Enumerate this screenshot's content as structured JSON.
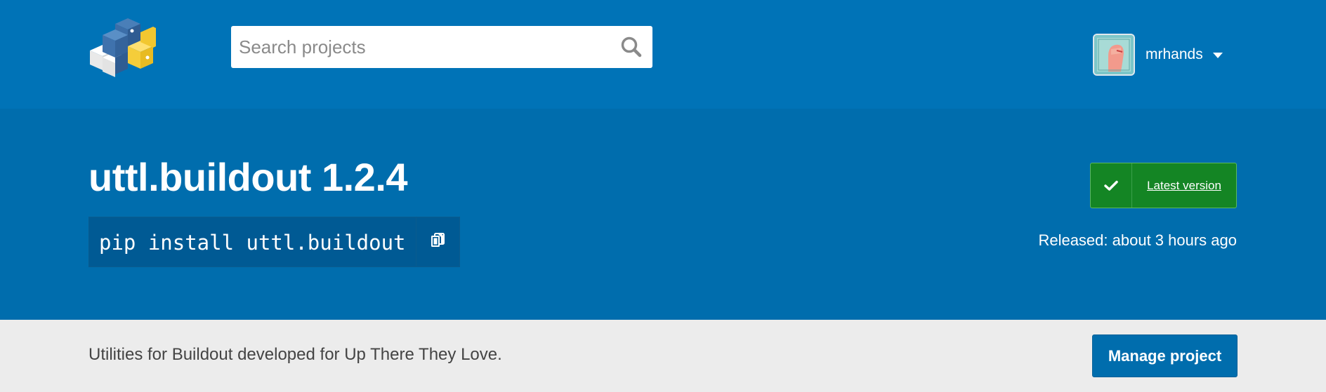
{
  "header": {
    "logo_icon": "pypi-cubes-logo-icon",
    "search": {
      "placeholder": "Search projects",
      "value": "",
      "icon": "search-icon"
    },
    "user": {
      "name": "mrhands",
      "avatar_icon": "avatar-image",
      "dropdown_icon": "caret-down-icon"
    }
  },
  "package": {
    "title": "uttl.buildout 1.2.4",
    "pip_command": "pip install uttl.buildout",
    "copy_icon": "copy-icon",
    "version_badge": {
      "label": "Latest version",
      "icon": "check-icon"
    },
    "released": "Released: about 3 hours ago"
  },
  "summary": {
    "description": "Utilities for Buildout developed for Up There They Love.",
    "manage_label": "Manage project"
  },
  "colors": {
    "header_bg": "#0073b7",
    "banner_bg": "#006dad",
    "badge_green": "#148524",
    "summary_bg": "#ececec"
  }
}
